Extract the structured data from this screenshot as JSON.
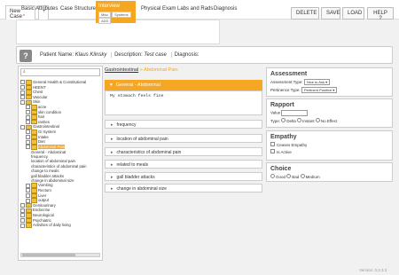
{
  "doc_tabs": [
    "New Case",
    "+"
  ],
  "doc_tab_marker": "*",
  "toolbar": {
    "delete": "DELETE",
    "save": "SAVE",
    "load": "LOAD",
    "help": "HELP ?"
  },
  "nav": [
    "Basic Attributes",
    "Case Structure",
    "Interview",
    "Physical Exam",
    "Labs and Rads",
    "Diagnosis"
  ],
  "interview_subtabs": [
    "Misc",
    "Systems",
    "ADD"
  ],
  "patient": {
    "name_label": "Patient Name:",
    "name": "Klaus Klinsky",
    "desc_label": "Description:",
    "desc": "Test case",
    "diagnosis_label": "Diagnosis:"
  },
  "search": {
    "value": "",
    "icon": "search-icon"
  },
  "tree": [
    {
      "indent": 0,
      "label": "General Health & Constitutional"
    },
    {
      "indent": 0,
      "label": "HEENT"
    },
    {
      "indent": 0,
      "label": "Chest"
    },
    {
      "indent": 0,
      "label": "Vascular"
    },
    {
      "indent": 0,
      "label": "Skin"
    },
    {
      "indent": 1,
      "label": "acne"
    },
    {
      "indent": 1,
      "label": "skin condition"
    },
    {
      "indent": 1,
      "label": "hair"
    },
    {
      "indent": 1,
      "label": "rashes"
    },
    {
      "indent": 0,
      "label": "Gastrointestinal"
    },
    {
      "indent": 1,
      "label": "GI System"
    },
    {
      "indent": 1,
      "label": "Intake"
    },
    {
      "indent": 1,
      "label": "Diet"
    },
    {
      "indent": 1,
      "label": "Abdominal Pain",
      "selected": true
    },
    {
      "indent": 2,
      "label": "General - Abdominal"
    },
    {
      "indent": 2,
      "label": "frequency"
    },
    {
      "indent": 2,
      "label": "location of abdominal pain"
    },
    {
      "indent": 2,
      "label": "characteristics of abdominal pain"
    },
    {
      "indent": 2,
      "label": "change to meals"
    },
    {
      "indent": 2,
      "label": "gall bladder attacks"
    },
    {
      "indent": 2,
      "label": "change in abdominal size"
    },
    {
      "indent": 1,
      "label": "Vomiting"
    },
    {
      "indent": 1,
      "label": "Rectum"
    },
    {
      "indent": 1,
      "label": "Liver"
    },
    {
      "indent": 1,
      "label": "output"
    },
    {
      "indent": 0,
      "label": "Genitourinary"
    },
    {
      "indent": 0,
      "label": "Endocrine"
    },
    {
      "indent": 0,
      "label": "Neurological"
    },
    {
      "indent": 0,
      "label": "Psychiatric"
    },
    {
      "indent": 0,
      "label": "Activities of daily living"
    }
  ],
  "breadcrumb": {
    "parent": "Gastrointestinal",
    "separator": "»",
    "current": "Abdominal Pain"
  },
  "active_question": {
    "title": "General - Abdominal",
    "answer": "My stomach feels fine"
  },
  "questions": [
    "frequency",
    "location of abdominal pain",
    "characteristics of abdominal pain",
    "related to meals",
    "gall bladder attacks",
    "change in abdominal size"
  ],
  "assessment": {
    "title": "Assessment",
    "type_label": "Assessment Type:",
    "type_value": "Nice to Ask",
    "pertinence_label": "Pertinence Type:",
    "pertinence_value": "Pertinent Positive"
  },
  "rapport": {
    "title": "Rapport",
    "value_label": "Value",
    "value": "",
    "type_label": "Type:",
    "options": [
      "Delta",
      "Instant",
      "No Effect"
    ]
  },
  "empathy": {
    "title": "Empathy",
    "options": [
      "Ceases Empathy",
      "Is Active"
    ]
  },
  "choice": {
    "title": "Choice",
    "options": [
      "Good",
      "Bad",
      "Medium"
    ]
  },
  "version": "Version: 0.2.3.3",
  "colors": {
    "accent": "#f5a623",
    "link": "#c0392b"
  }
}
